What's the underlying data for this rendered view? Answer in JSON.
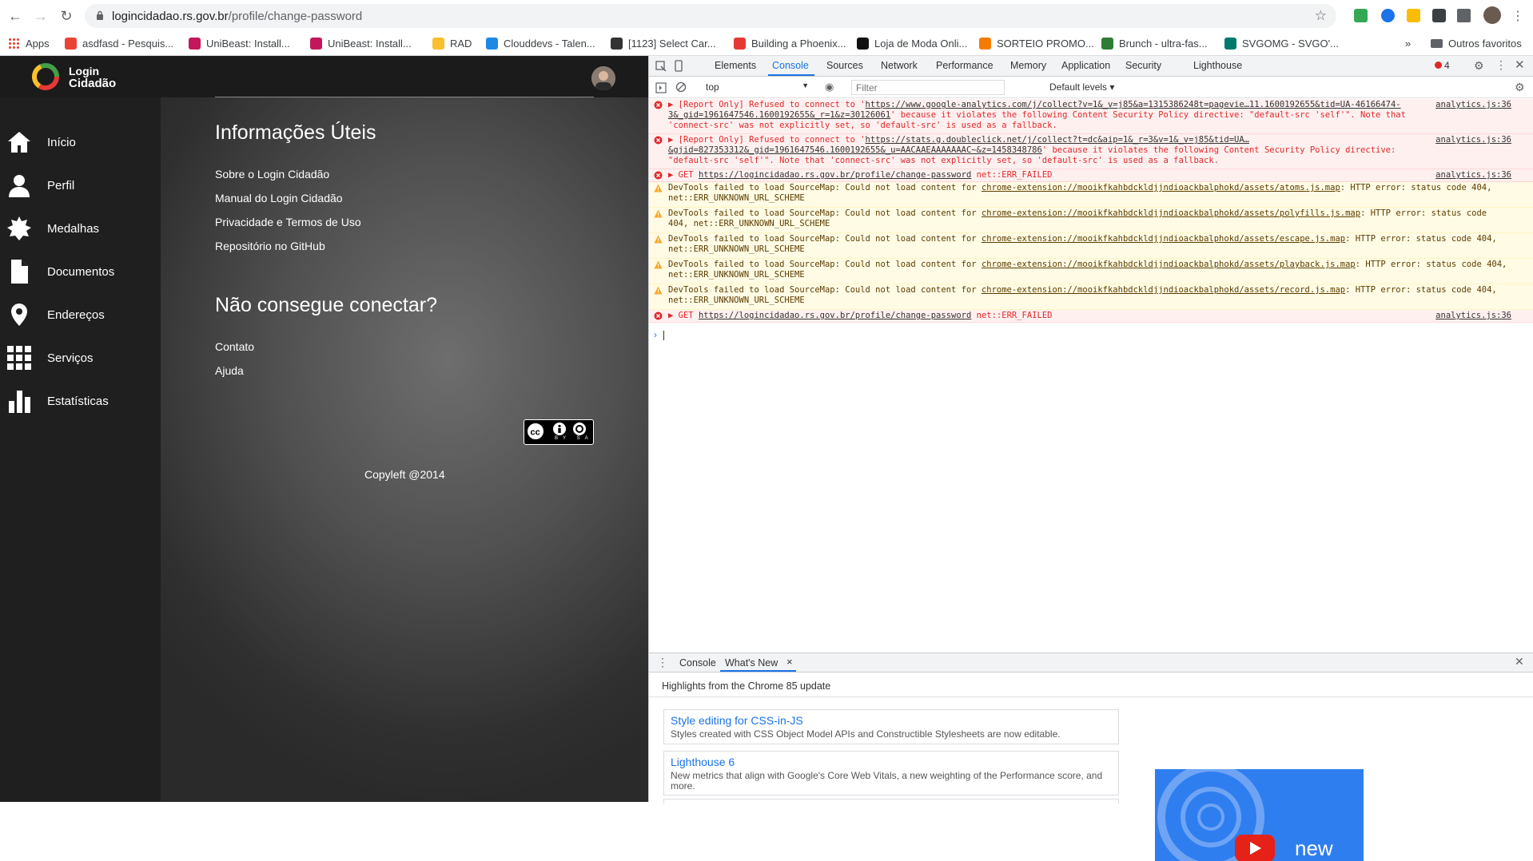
{
  "browser": {
    "url_host": "logincidadao.rs.gov.br",
    "url_path": "/profile/change-password",
    "bookmarks": [
      {
        "label": "Apps",
        "icon": "apps-grid-icon"
      },
      {
        "label": "asdfasd - Pesquis...",
        "icon": "google-icon"
      },
      {
        "label": "UniBeast: Install...",
        "icon": "raspberry-icon"
      },
      {
        "label": "UniBeast: Install...",
        "icon": "raspberry-icon"
      },
      {
        "label": "RAD",
        "icon": "rad-icon"
      },
      {
        "label": "Clouddevs - Talen...",
        "icon": "clouddevs-icon"
      },
      {
        "label": "[1123] Select Car...",
        "icon": "github-icon"
      },
      {
        "label": "Building a Phoenix...",
        "icon": "phoenix-icon"
      },
      {
        "label": "Loja de Moda Onli...",
        "icon": "z-icon"
      },
      {
        "label": "SORTEIO PROMO...",
        "icon": "sorteio-icon"
      },
      {
        "label": "Brunch - ultra-fas...",
        "icon": "brunch-icon"
      },
      {
        "label": "SVGOMG - SVGO'...",
        "icon": "svgomg-icon"
      }
    ],
    "other_bookmarks": "Outros favoritos",
    "more": "»"
  },
  "site": {
    "logo_line1": "Login",
    "logo_line2": "Cidadão",
    "sidebar": [
      {
        "label": "Início",
        "icon": "home-icon"
      },
      {
        "label": "Perfil",
        "icon": "user-icon"
      },
      {
        "label": "Medalhas",
        "icon": "medal-icon"
      },
      {
        "label": "Documentos",
        "icon": "document-icon"
      },
      {
        "label": "Endereços",
        "icon": "map-pin-icon"
      },
      {
        "label": "Serviços",
        "icon": "grid-icon"
      },
      {
        "label": "Estatísticas",
        "icon": "bar-chart-icon"
      }
    ],
    "useful_title": "Informações Úteis",
    "useful_links": [
      "Sobre o Login Cidadão",
      "Manual do Login Cidadão",
      "Privacidade e Termos de Uso",
      "Repositório no GitHub"
    ],
    "connect_title": "Não consegue conectar?",
    "connect_links": [
      "Contato",
      "Ajuda"
    ],
    "cc_text": "BY  SA",
    "copyleft": "Copyleft @2014"
  },
  "devtools": {
    "tabs": [
      "Elements",
      "Console",
      "Sources",
      "Network",
      "Performance",
      "Memory",
      "Application",
      "Security",
      "Lighthouse"
    ],
    "active_tab": "Console",
    "error_count": "4",
    "context": "top",
    "filter_placeholder": "Filter",
    "levels": "Default levels ▾",
    "messages": [
      {
        "type": "err",
        "pre": "▶ [Report Only] Refused to connect to '",
        "link": "https://www.google-analytics.com/j/collect?v=1&_v=j85&a=1315386248t=pagevie…11.1600192655&tid=UA-46166474-3&_gid=1961647546.1600192655&_r=1&z=30126061",
        "post": "' because it violates the following Content Security Policy directive: \"default-src 'self'\". Note that 'connect-src' was not explicitly set, so 'default-src' is used as a fallback.",
        "source": "analytics.js:36"
      },
      {
        "type": "err",
        "pre": "▶ [Report Only] Refused to connect to '",
        "link": "https://stats.g.doubleclick.net/j/collect?t=dc&aip=1&_r=3&v=1&_v=j85&tid=UA…&gjid=827353312&_gid=1961647546.1600192655&_u=AACAAEAAAAAAAC~&z=1458348786",
        "post": "' because it violates the following Content Security Policy directive: \"default-src 'self'\". Note that 'connect-src' was not explicitly set, so 'default-src' is used as a fallback.",
        "source": "analytics.js:36"
      },
      {
        "type": "err",
        "pre": "▶ GET ",
        "link": "https://logincidadao.rs.gov.br/profile/change-password",
        "post": " net::ERR_FAILED",
        "source": "analytics.js:36"
      },
      {
        "type": "warn",
        "pre": "DevTools failed to load SourceMap: Could not load content for ",
        "link": "chrome-extension://mooikfkahbdckldjjndioackbalphokd/assets/atoms.js.map",
        "post": ": HTTP error: status code 404, net::ERR_UNKNOWN_URL_SCHEME",
        "source": ""
      },
      {
        "type": "warn",
        "pre": "DevTools failed to load SourceMap: Could not load content for ",
        "link": "chrome-extension://mooikfkahbdckldjjndioackbalphokd/assets/polyfills.js.map",
        "post": ": HTTP error: status code 404, net::ERR_UNKNOWN_URL_SCHEME",
        "source": ""
      },
      {
        "type": "warn",
        "pre": "DevTools failed to load SourceMap: Could not load content for ",
        "link": "chrome-extension://mooikfkahbdckldjjndioackbalphokd/assets/escape.js.map",
        "post": ": HTTP error: status code 404, net::ERR_UNKNOWN_URL_SCHEME",
        "source": ""
      },
      {
        "type": "warn",
        "pre": "DevTools failed to load SourceMap: Could not load content for ",
        "link": "chrome-extension://mooikfkahbdckldjjndioackbalphokd/assets/playback.js.map",
        "post": ": HTTP error: status code 404, net::ERR_UNKNOWN_URL_SCHEME",
        "source": ""
      },
      {
        "type": "warn",
        "pre": "DevTools failed to load SourceMap: Could not load content for ",
        "link": "chrome-extension://mooikfkahbdckldjjndioackbalphokd/assets/record.js.map",
        "post": ": HTTP error: status code 404, net::ERR_UNKNOWN_URL_SCHEME",
        "source": ""
      },
      {
        "type": "err",
        "pre": "▶ GET ",
        "link": "https://logincidadao.rs.gov.br/profile/change-password",
        "post": " net::ERR_FAILED",
        "source": "analytics.js:36"
      }
    ],
    "drawer_tabs": [
      "Console",
      "What's New"
    ],
    "drawer_active": "What's New",
    "whats_new_title": "Highlights from the Chrome 85 update",
    "cards": [
      {
        "title": "Style editing for CSS-in-JS",
        "desc": "Styles created with CSS Object Model APIs and Constructible Stylesheets are now editable."
      },
      {
        "title": "Lighthouse 6",
        "desc": "New metrics that align with Google's Core Web Vitals, a new weighting of the Performance score, and more."
      }
    ],
    "promo_text": "new"
  },
  "colors": {
    "error": "#e02828",
    "accent": "#1a73e8",
    "sidebar": "#1f1f1f"
  }
}
